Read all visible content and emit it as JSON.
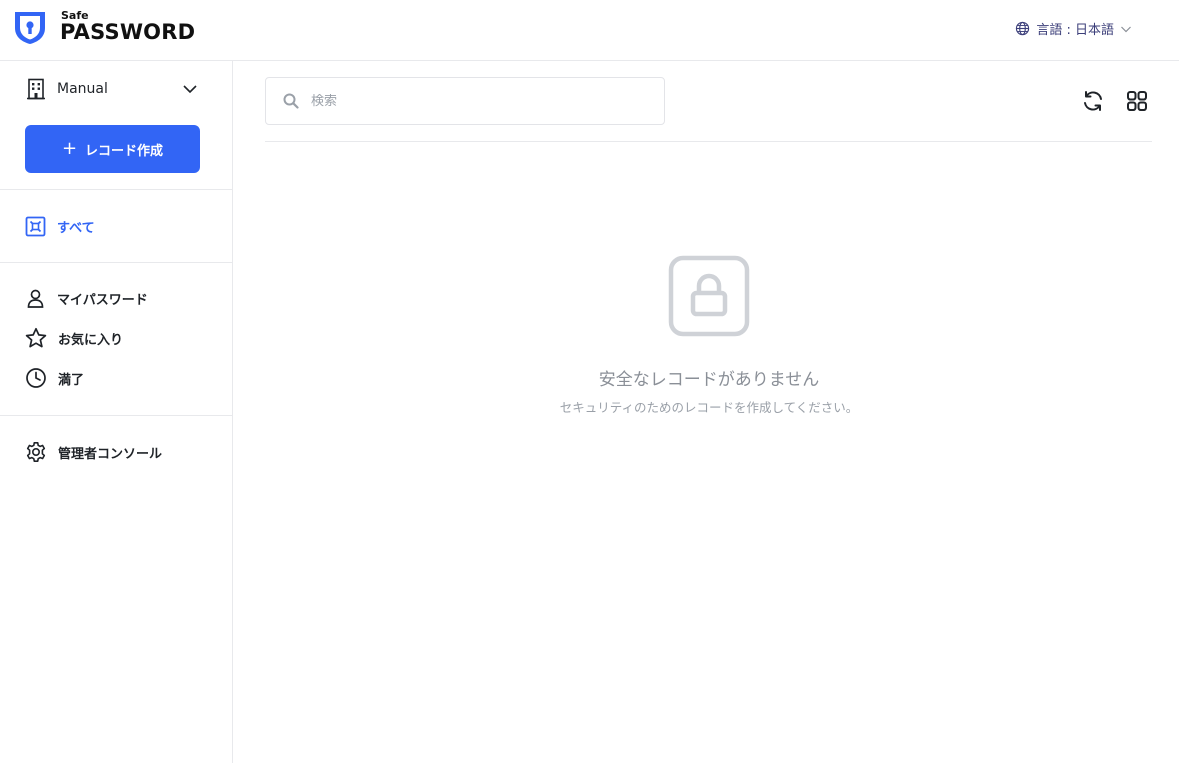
{
  "brand": {
    "small": "Safe",
    "big": "PASSWORD",
    "color": "#3265f5"
  },
  "header": {
    "language_label": "言語 : 日本語"
  },
  "sidebar": {
    "org_name": "Manual",
    "create_label": "レコード作成",
    "items": [
      {
        "id": "all",
        "label": "すべて",
        "icon": "all-records-icon",
        "active": true
      },
      {
        "id": "my",
        "label": "マイパスワード",
        "icon": "user-icon"
      },
      {
        "id": "fav",
        "label": "お気に入り",
        "icon": "star-icon"
      },
      {
        "id": "expired",
        "label": "満了",
        "icon": "clock-icon"
      },
      {
        "id": "admin",
        "label": "管理者コンソール",
        "icon": "gear-icon"
      }
    ]
  },
  "main": {
    "search_placeholder": "検索",
    "empty_title": "安全なレコードがありません",
    "empty_subtitle": "セキュリティのためのレコードを作成してください。"
  },
  "colors": {
    "accent": "#3265f5",
    "text": "#1f2328",
    "muted": "#8a8f97",
    "border": "#e8e9ec"
  }
}
